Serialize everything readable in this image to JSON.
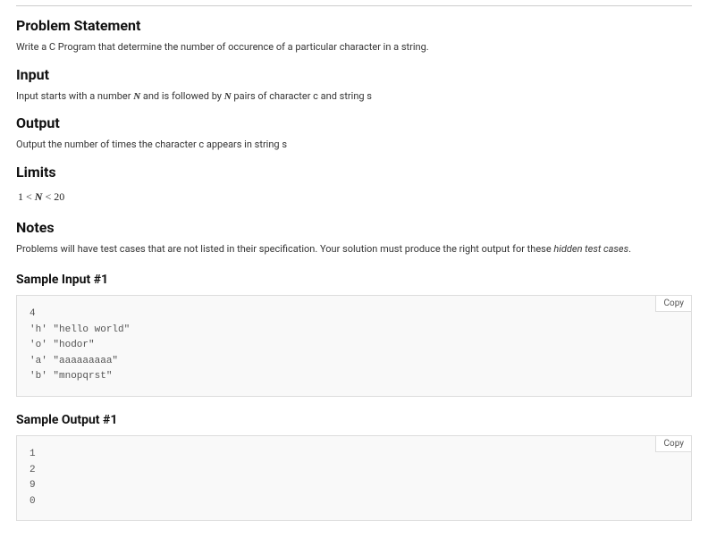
{
  "sections": {
    "problem_statement": {
      "heading": "Problem Statement",
      "body": "Write a C Program that determine the number of occurence of a particular character in a string."
    },
    "input": {
      "heading": "Input",
      "body_pre": "Input starts with a number ",
      "body_mid": " and is followed by ",
      "body_post": " pairs of character c and string s",
      "math_symbol": "N"
    },
    "output": {
      "heading": "Output",
      "body": "Output the number of times the character c appears in string s"
    },
    "limits": {
      "heading": "Limits",
      "expr_pre": "1 < ",
      "expr_var": "N",
      "expr_post": " < 20"
    },
    "notes": {
      "heading": "Notes",
      "body_pre": "Problems will have test cases that are not listed in their specification. Your solution must produce the right output for these ",
      "body_italic": "hidden test cases",
      "body_post": "."
    }
  },
  "samples": {
    "input1": {
      "heading": "Sample Input #1",
      "copy_label": "Copy",
      "content": "4\n'h' \"hello world\"\n'o' \"hodor\"\n'a' \"aaaaaaaaa\"\n'b' \"mnopqrst\""
    },
    "output1": {
      "heading": "Sample Output #1",
      "copy_label": "Copy",
      "content": "1\n2\n9\n0"
    }
  }
}
